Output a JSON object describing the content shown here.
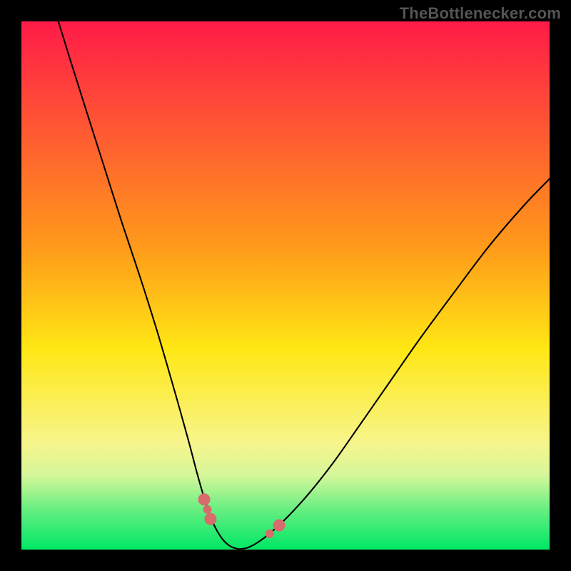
{
  "watermark": "TheBottlenecker.com",
  "chart_data": {
    "type": "line",
    "title": "",
    "xlabel": "",
    "ylabel": "",
    "xlim": [
      0,
      100
    ],
    "ylim": [
      0,
      100
    ],
    "background_gradient": {
      "stops": [
        {
          "offset": 0.0,
          "color": "#ff1b48"
        },
        {
          "offset": 0.43,
          "color": "#ff9b1a"
        },
        {
          "offset": 0.62,
          "color": "#ffe714"
        },
        {
          "offset": 0.8,
          "color": "#f7f58d"
        },
        {
          "offset": 0.86,
          "color": "#d4f79a"
        },
        {
          "offset": 0.93,
          "color": "#5eee7f"
        },
        {
          "offset": 1.0,
          "color": "#00e765"
        }
      ]
    },
    "series": [
      {
        "name": "left-leg",
        "stroke": "#000000",
        "stroke_width": 2.1,
        "points": [
          {
            "x": 7.0,
            "y": 100.0
          },
          {
            "x": 9.0,
            "y": 93.5
          },
          {
            "x": 12.0,
            "y": 84.0
          },
          {
            "x": 15.5,
            "y": 73.0
          },
          {
            "x": 19.0,
            "y": 62.0
          },
          {
            "x": 22.5,
            "y": 51.5
          },
          {
            "x": 25.5,
            "y": 42.0
          },
          {
            "x": 28.0,
            "y": 33.5
          },
          {
            "x": 30.0,
            "y": 26.5
          },
          {
            "x": 31.8,
            "y": 20.0
          },
          {
            "x": 33.3,
            "y": 14.3
          },
          {
            "x": 34.6,
            "y": 9.8
          },
          {
            "x": 35.7,
            "y": 6.5
          },
          {
            "x": 36.9,
            "y": 3.8
          },
          {
            "x": 38.3,
            "y": 1.7
          },
          {
            "x": 39.7,
            "y": 0.55
          },
          {
            "x": 41.2,
            "y": 0.08
          }
        ]
      },
      {
        "name": "right-leg",
        "stroke": "#000000",
        "stroke_width": 2.1,
        "points": [
          {
            "x": 41.2,
            "y": 0.08
          },
          {
            "x": 42.8,
            "y": 0.35
          },
          {
            "x": 44.8,
            "y": 1.4
          },
          {
            "x": 47.3,
            "y": 3.3
          },
          {
            "x": 50.5,
            "y": 6.3
          },
          {
            "x": 54.5,
            "y": 10.7
          },
          {
            "x": 59.0,
            "y": 16.4
          },
          {
            "x": 64.0,
            "y": 23.5
          },
          {
            "x": 69.5,
            "y": 31.4
          },
          {
            "x": 75.5,
            "y": 40.0
          },
          {
            "x": 82.0,
            "y": 48.8
          },
          {
            "x": 88.5,
            "y": 57.4
          },
          {
            "x": 95.0,
            "y": 65.0
          },
          {
            "x": 100.0,
            "y": 70.2
          }
        ]
      }
    ],
    "markers": {
      "color": "#d86b6b",
      "radius_large": 8.5,
      "radius_small": 6.0,
      "rounded_rect": {
        "x_center": 40.5,
        "y": 0.0,
        "width": 10.5,
        "height": 0.011,
        "rx": 0.006
      },
      "points": [
        {
          "x": 34.6,
          "y": 9.5,
          "size": "large"
        },
        {
          "x": 35.2,
          "y": 7.6,
          "size": "small"
        },
        {
          "x": 35.8,
          "y": 5.8,
          "size": "large"
        },
        {
          "x": 47.0,
          "y": 3.0,
          "size": "small"
        },
        {
          "x": 48.8,
          "y": 4.6,
          "size": "large"
        }
      ]
    }
  }
}
